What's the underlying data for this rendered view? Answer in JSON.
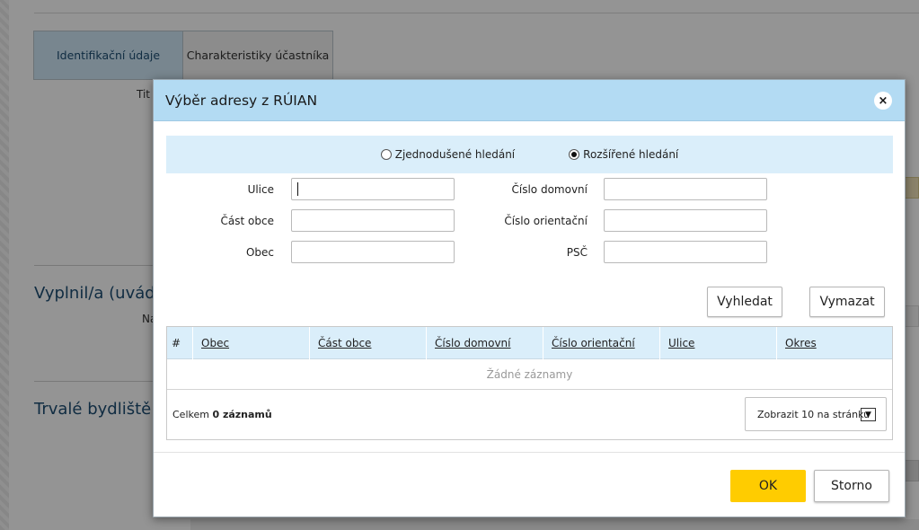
{
  "background": {
    "tabs": [
      "Identifikační údaje",
      "Charakteristiky účastníka"
    ],
    "titul_label_fragment": "Tit",
    "section_filled_by": "Vyplnil/a (uvád",
    "name_label_fragment": "Na",
    "section_residence": "Trvalé bydliště"
  },
  "dialog": {
    "title": "Výběr adresy z RÚIAN",
    "close_glyph": "×",
    "modes": [
      {
        "label": "Zjednodušené hledání",
        "selected": false
      },
      {
        "label": "Rozšířené hledání",
        "selected": true
      }
    ],
    "fields": {
      "ulice": {
        "label": "Ulice",
        "value": ""
      },
      "cast_obce": {
        "label": "Část obce",
        "value": ""
      },
      "obec": {
        "label": "Obec",
        "value": ""
      },
      "cislo_domovni": {
        "label": "Číslo domovní",
        "value": ""
      },
      "cislo_orientacni": {
        "label": "Číslo orientační",
        "value": ""
      },
      "psc": {
        "label": "PSČ",
        "value": ""
      }
    },
    "search_button": "Vyhledat",
    "clear_button": "Vymazat",
    "grid": {
      "columns": [
        "#",
        "Obec",
        "Část obce",
        "Číslo domovní",
        "Číslo orientační",
        "Ulice",
        "Okres"
      ],
      "empty_text": "Žádné záznamy",
      "total_prefix": "Celkem",
      "total_count": "0 záznamů",
      "page_size_label": "Zobrazit 10 na stránku",
      "dropdown_glyph": "▼"
    },
    "ok_button": "OK",
    "cancel_button": "Storno"
  }
}
